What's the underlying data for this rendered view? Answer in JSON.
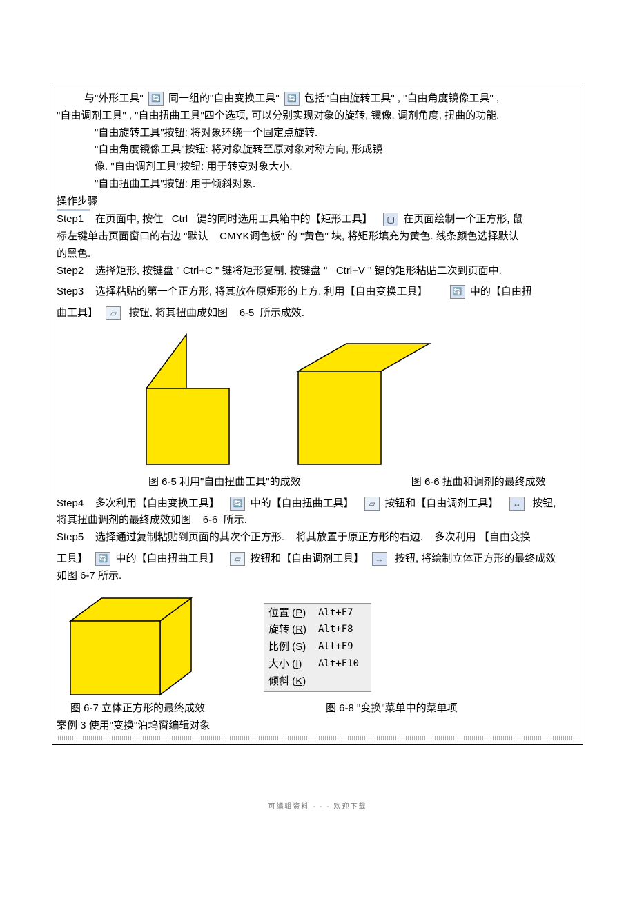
{
  "intro": {
    "line1a": "与\"外形工具\"",
    "line1b": "同一组的\"自由变换工具\"",
    "line1c": "包括\"自由旋转工具\" , \"自由角度镜像工具\" ,",
    "line2": "\"自由调剂工具\" , \"自由扭曲工具\"四个选项, 可以分别实现对象的旋转, 镜像, 调剂角度, 扭曲的功能.",
    "b1": "\"自由旋转工具\"按钮: 将对象环绕一个固定点旋转.",
    "b2": "\"自由角度镜像工具\"按钮: 将对象旋转至原对象对称方向, 形成镜",
    "b3": "像. \"自由调剂工具\"按钮: 用于转变对象大小.",
    "b4": "\"自由扭曲工具\"按钮: 用于倾斜对象.",
    "ops": "操作步骤"
  },
  "steps": {
    "s1": {
      "label": "Step1",
      "a": "在页面中, 按住",
      "ctrl": "Ctrl",
      "b": "键的同时选用工具箱中的【矩形工具】",
      "c": "在页面绘制一个正方形, 鼠"
    },
    "s1b": "标左键单击页面窗口的右边 \"默认",
    "s1c": "CMYK调色板\" 的 \"黄色\" 块, 将矩形填充为黄色. 线条颜色选择默认",
    "s1d": "的黑色.",
    "s2": {
      "label": "Step2",
      "a": "选择矩形, 按键盘 \"",
      "cc": "Ctrl+C",
      "b": "\" 键将矩形复制, 按键盘 \"",
      "cv": "Ctrl+V",
      "c": "\" 键的矩形粘贴二次到页面中."
    },
    "s3": {
      "label": "Step3",
      "a": "选择粘贴的第一个正方形, 将其放在原矩形的上方. 利用【自由变换工具】",
      "b": "中的【自由扭"
    },
    "s3b": {
      "a": "曲工具】",
      "b": "按钮, 将其扭曲成如图",
      "c": "6-5",
      "d": "所示成效."
    },
    "fig65": "图 6-5  利用\"自由扭曲工具\"的成效",
    "fig66": "图 6-6  扭曲和调剂的最终成效",
    "s4": {
      "label": "Step4",
      "a": "多次利用【自由变换工具】",
      "b": "中的【自由扭曲工具】",
      "c": "按钮和【自由调剂工具】",
      "d": "按钮,"
    },
    "s4b": {
      "a": "将其扭曲调剂的最终成效如图",
      "b": "6-6",
      "c": "所示."
    },
    "s5": {
      "label": "Step5",
      "a": "选择通过复制粘贴到页面的其次个正方形.",
      "b": "将其放置于原正方形的右边.",
      "c": "多次利用 【自由变换"
    },
    "s5b": {
      "a": "工具】",
      "b": "中的【自由扭曲工具】",
      "c": "按钮和【自由调剂工具】",
      "d": "按钮, 将绘制立体正方形的最终成效"
    },
    "s5c": "如图 6-7 所示.",
    "fig67": "图 6-7  立体正方形的最终成效",
    "fig68": "图 6-8  \"变换\"菜单中的菜单项",
    "case3": "案例  3    使用\"变换\"泊坞窗编辑对象"
  },
  "menu": {
    "r1": {
      "label": "位置",
      "k": "P",
      "short": "Alt+F7"
    },
    "r2": {
      "label": "旋转",
      "k": "R",
      "short": "Alt+F8"
    },
    "r3": {
      "label": "比例",
      "k": "S",
      "short": "Alt+F9"
    },
    "r4": {
      "label": "大小",
      "k": "I",
      "short": "Alt+F10"
    },
    "r5": {
      "label": "倾斜",
      "k": "K",
      "short": ""
    }
  },
  "footer": "可编辑资料   -  -  -  欢迎下载"
}
